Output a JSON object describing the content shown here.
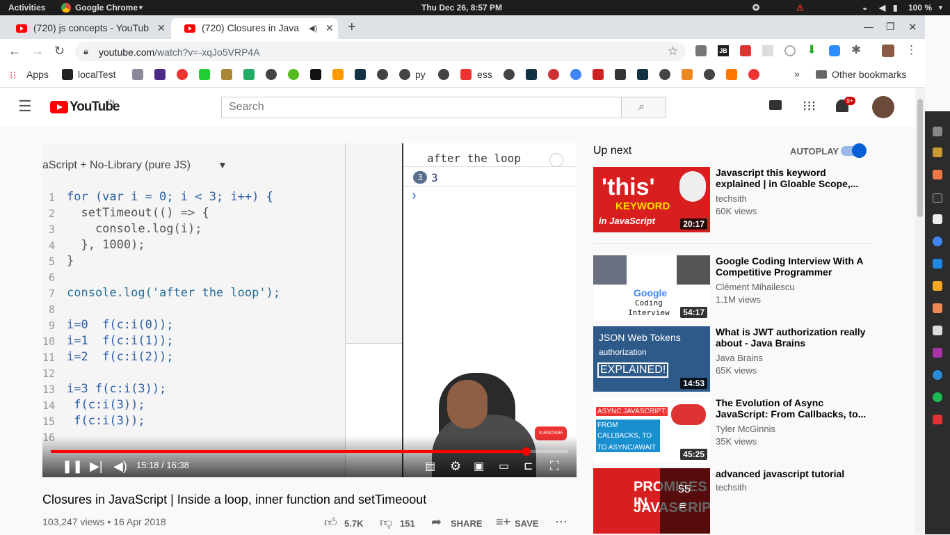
{
  "system": {
    "activities": "Activities",
    "app": "Google Chrome",
    "clock": "Thu Dec 26,  8:57 PM",
    "battery": "100 %"
  },
  "tabs": [
    {
      "title": "(720) js concepts - YouTub"
    },
    {
      "title": "(720) Closures in Java"
    }
  ],
  "omnibox": {
    "domain": "youtube.com",
    "path": "/watch?v=-xqJo5VRP4A"
  },
  "bookmarks": {
    "apps": "Apps",
    "localtest": "localTest",
    "py": "py",
    "ess": "ess",
    "other": "Other bookmarks"
  },
  "youtube": {
    "logo": "YouTube",
    "region": "IN",
    "search_placeholder": "Search",
    "notif_count": "9+"
  },
  "video": {
    "lang_label": "aScript + No-Library (pure JS)",
    "console_text": "after the loop",
    "console_count": "3",
    "console_value": "3",
    "console_prompt": "›",
    "code_lines": [
      "for (var i = 0; i < 3; i++) {",
      "  setTimeout(() => {",
      "    console.log(i);",
      "  }, 1000);",
      "}",
      "",
      "console.log('after the loop');",
      "",
      "i=0  f(c:i(0));",
      "i=1  f(c:i(1));",
      "i=2  f(c:i(2));",
      "",
      "i=3 f(c:i(3));",
      " f(c:i(3));",
      " f(c:i(3));",
      ""
    ],
    "line_numbers": [
      "1",
      "2",
      "3",
      "4",
      "5",
      "6",
      "7",
      "8",
      "9",
      "10",
      "11",
      "12",
      "13",
      "14",
      "15",
      "16"
    ],
    "time": "15:18 / 16:38",
    "progress": 0.92,
    "subscribe": "SUBSCRIBE"
  },
  "meta": {
    "title": "Closures in JavaScript | Inside a loop, inner function and setTimeoout",
    "views": "103,247 views • 16 Apr 2018",
    "likes": "5.7K",
    "dislikes": "151",
    "share": "SHARE",
    "save": "SAVE"
  },
  "upnext": {
    "label": "Up next",
    "autoplay": "AUTOPLAY",
    "items": [
      {
        "title": "Javascript this keyword explained | in Gloable Scope,...",
        "channel": "techsith",
        "views": "60K views",
        "duration": "20:17",
        "thumb_text1": "'this'",
        "thumb_text2": "KEYWORD",
        "thumb_text3": "in JavaScript"
      },
      {
        "title": "Google Coding Interview With A Competitive Programmer",
        "channel": "Clément Mihailescu",
        "views": "1.1M views",
        "duration": "54:17",
        "thumb_text1": "Google",
        "thumb_text2": "Coding",
        "thumb_text3": "Interview"
      },
      {
        "title": "What is JWT authorization really about - Java Brains",
        "channel": "Java Brains",
        "views": "65K views",
        "duration": "14:53",
        "thumb_text1": "JSON Web Tokens",
        "thumb_text2": "authorization",
        "thumb_text3": "EXPLAINED!"
      },
      {
        "title": "The Evolution of Async JavaScript: From Callbacks, to...",
        "channel": "Tyler McGinnis",
        "views": "35K views",
        "duration": "45:25",
        "thumb_text1": "ASYNC JAVASCRIPT:",
        "thumb_text2": "FROM CALLBACKS, TO PROMISES,",
        "thumb_text3": "TO ASYNC/AWAIT"
      },
      {
        "title": "advanced javascript tutorial",
        "channel": "techsith",
        "views": "",
        "duration": "55",
        "thumb_text1": "PROMISES IN",
        "thumb_text2": "JAVASCRIPT",
        "thumb_text3": ""
      }
    ]
  },
  "colors": {
    "yt_red": "#ff0000",
    "autoplay_blue": "#065fd4"
  }
}
